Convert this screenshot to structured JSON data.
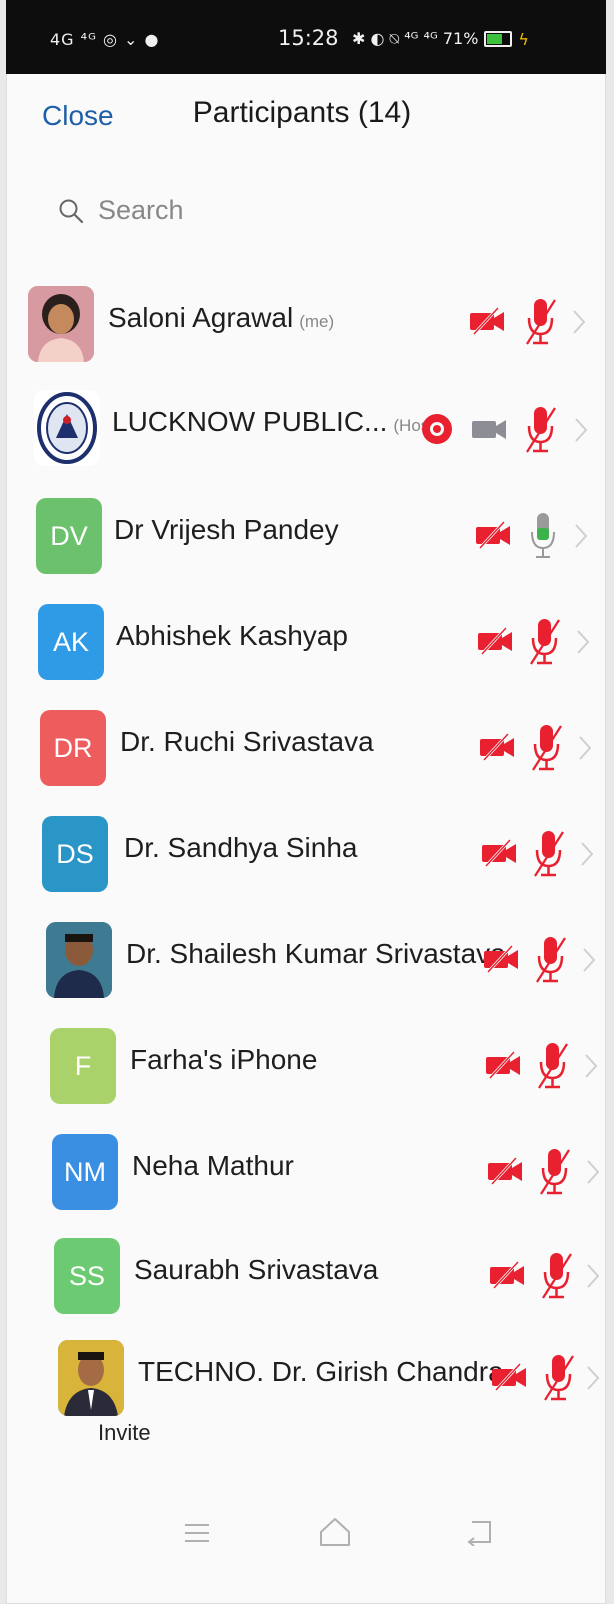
{
  "status_bar": {
    "left": "4G ⁴ᴳ ◎ ⌄ ●",
    "time": "15:28",
    "right": "✱ ◐ ⍉ ⁴ᴳ ⁴ᴳ 71%"
  },
  "header": {
    "close_label": "Close",
    "title": "Participants (14)"
  },
  "search": {
    "placeholder": "Search"
  },
  "participants": [
    {
      "name": "Saloni Agrawal",
      "tag": "(me)",
      "initials": "",
      "avatar_color": "#c7868c",
      "video": "off",
      "mic": "muted"
    },
    {
      "name": "LUCKNOW PUBLIC...",
      "tag": "(Host)",
      "initials": "",
      "avatar_color": "#ffffff",
      "video": "off-grey",
      "mic": "muted",
      "recording": true
    },
    {
      "name": "Dr Vrijesh Pandey",
      "tag": "",
      "initials": "DV",
      "avatar_color": "#6cc26c",
      "video": "off",
      "mic": "on"
    },
    {
      "name": "Abhishek Kashyap",
      "tag": "",
      "initials": "AK",
      "avatar_color": "#2f9be6",
      "video": "off",
      "mic": "muted"
    },
    {
      "name": "Dr. Ruchi Srivastava",
      "tag": "",
      "initials": "DR",
      "avatar_color": "#ee5d5d",
      "video": "off",
      "mic": "muted"
    },
    {
      "name": "Dr. Sandhya Sinha",
      "tag": "",
      "initials": "DS",
      "avatar_color": "#2a96c7",
      "video": "off",
      "mic": "muted"
    },
    {
      "name": "Dr. Shailesh Kumar Srivastava",
      "tag": "",
      "initials": "",
      "avatar_color": "#3d6b8a",
      "video": "off",
      "mic": "muted"
    },
    {
      "name": "Farha's iPhone",
      "tag": "",
      "initials": "F",
      "avatar_color": "#a9d36a",
      "video": "off",
      "mic": "muted"
    },
    {
      "name": "Neha Mathur",
      "tag": "",
      "initials": "NM",
      "avatar_color": "#3a8fe3",
      "video": "off",
      "mic": "muted"
    },
    {
      "name": "Saurabh Srivastava",
      "tag": "",
      "initials": "SS",
      "avatar_color": "#6ccb72",
      "video": "off",
      "mic": "muted"
    },
    {
      "name": "TECHNO. Dr. Girish Chandra...",
      "tag": "",
      "initials": "",
      "avatar_color": "#5a7b3e",
      "video": "off",
      "mic": "muted"
    }
  ],
  "footer": {
    "invite_label": "Invite"
  },
  "colors": {
    "accent": "#1f5fa8",
    "muted_red": "#e8202f",
    "mic_on_green": "#3cb34a",
    "video_grey": "#8d8d95",
    "recording": "#e8202f"
  }
}
